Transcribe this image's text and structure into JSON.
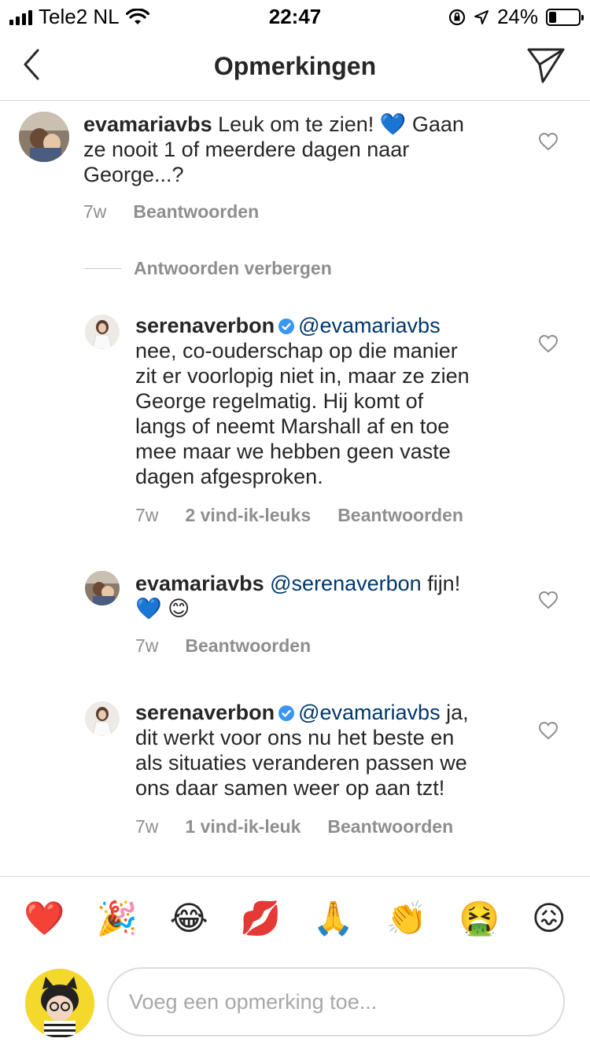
{
  "status_bar": {
    "carrier": "Tele2 NL",
    "time": "22:47",
    "battery": "24%",
    "icons": [
      "signal-icon",
      "wifi-icon",
      "orientation-lock-icon",
      "location-icon",
      "battery-icon"
    ]
  },
  "header": {
    "title": "Opmerkingen",
    "back_icon": "chevron-left-icon",
    "share_icon": "paper-plane-icon"
  },
  "comments": [
    {
      "username": "evamariavbs",
      "text": "Leuk om te zien! 💙 Gaan ze nooit 1 of meerdere dagen naar George...?",
      "text_line1": "Leuk om te zien! 💙 Gaan",
      "text_line2": "ze nooit 1 of meerdere dagen naar",
      "text_line3": "George...?",
      "time": "7w",
      "reply_label": "Beantwoorden"
    }
  ],
  "hide_replies_label": "Antwoorden verbergen",
  "replies": [
    {
      "username": "serenaverbon",
      "verified": true,
      "mention": "@evamariavbs",
      "lines": [
        "nee, co-ouderschap op die manier",
        "zit er voorlopig niet in, maar ze zien",
        "George regelmatig. Hij komt of",
        "langs of neemt Marshall af en toe",
        "mee maar we hebben geen vaste",
        "dagen afgesproken."
      ],
      "time": "7w",
      "likes": "2 vind-ik-leuks",
      "reply_label": "Beantwoorden"
    },
    {
      "username": "evamariavbs",
      "verified": false,
      "mention": "@serenaverbon",
      "text_after_mention": "fijn!",
      "line2": "💙 😊",
      "time": "7w",
      "reply_label": "Beantwoorden"
    },
    {
      "username": "serenaverbon",
      "verified": true,
      "mention": "@evamariavbs",
      "text_after_mention": "ja,",
      "lines": [
        "dit werkt voor ons nu het beste en",
        "als situaties veranderen passen we",
        "ons daar samen weer op aan tzt!"
      ],
      "time": "7w",
      "likes": "1 vind-ik-leuk",
      "reply_label": "Beantwoorden"
    }
  ],
  "emoji_bar": [
    "❤️",
    "🎉",
    "😂",
    "💋",
    "🙏",
    "👏",
    "🤮",
    "😖"
  ],
  "comment_input": {
    "placeholder": "Voeg een opmerking toe...",
    "value": ""
  },
  "colors": {
    "text": "#262626",
    "secondary": "#8e8e8e",
    "mention": "#00376b",
    "verified": "#3897f0",
    "divider": "#dbdbdb"
  }
}
